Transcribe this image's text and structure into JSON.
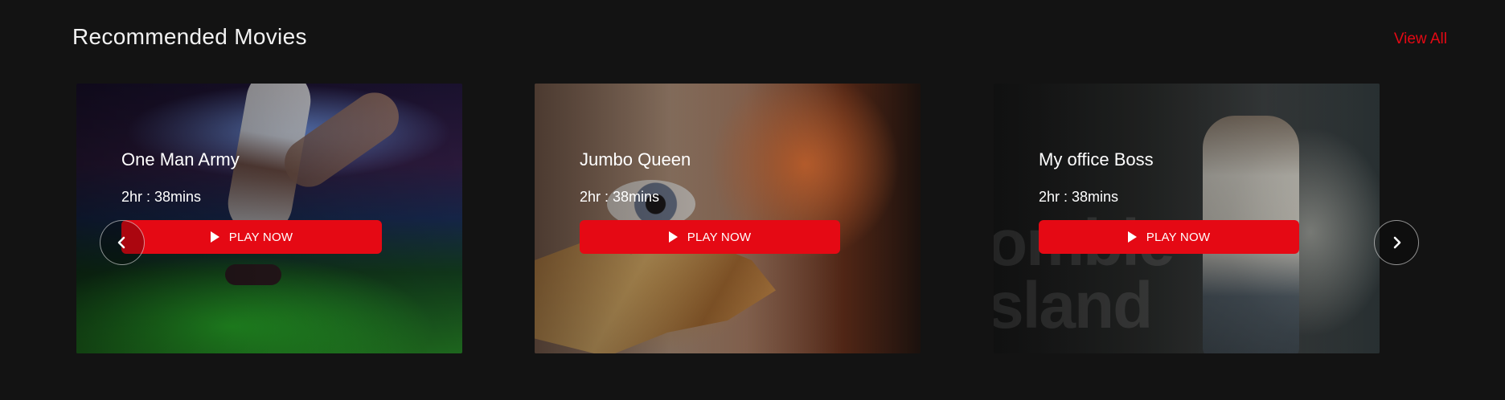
{
  "section": {
    "title": "Recommended Movies",
    "view_all_label": "View All"
  },
  "movies": [
    {
      "title": "One Man Army",
      "duration": "2hr : 38mins",
      "play_label": "PLAY NOW"
    },
    {
      "title": "Jumbo Queen",
      "duration": "2hr : 38mins",
      "play_label": "PLAY NOW"
    },
    {
      "title": "My office Boss",
      "duration": "2hr : 38mins",
      "play_label": "PLAY NOW",
      "poster_text": "ombie\nsland"
    }
  ],
  "icons": {
    "prev": "chevron-left-icon",
    "next": "chevron-right-icon",
    "play": "play-icon"
  },
  "colors": {
    "accent": "#e50914",
    "background": "#131313"
  }
}
